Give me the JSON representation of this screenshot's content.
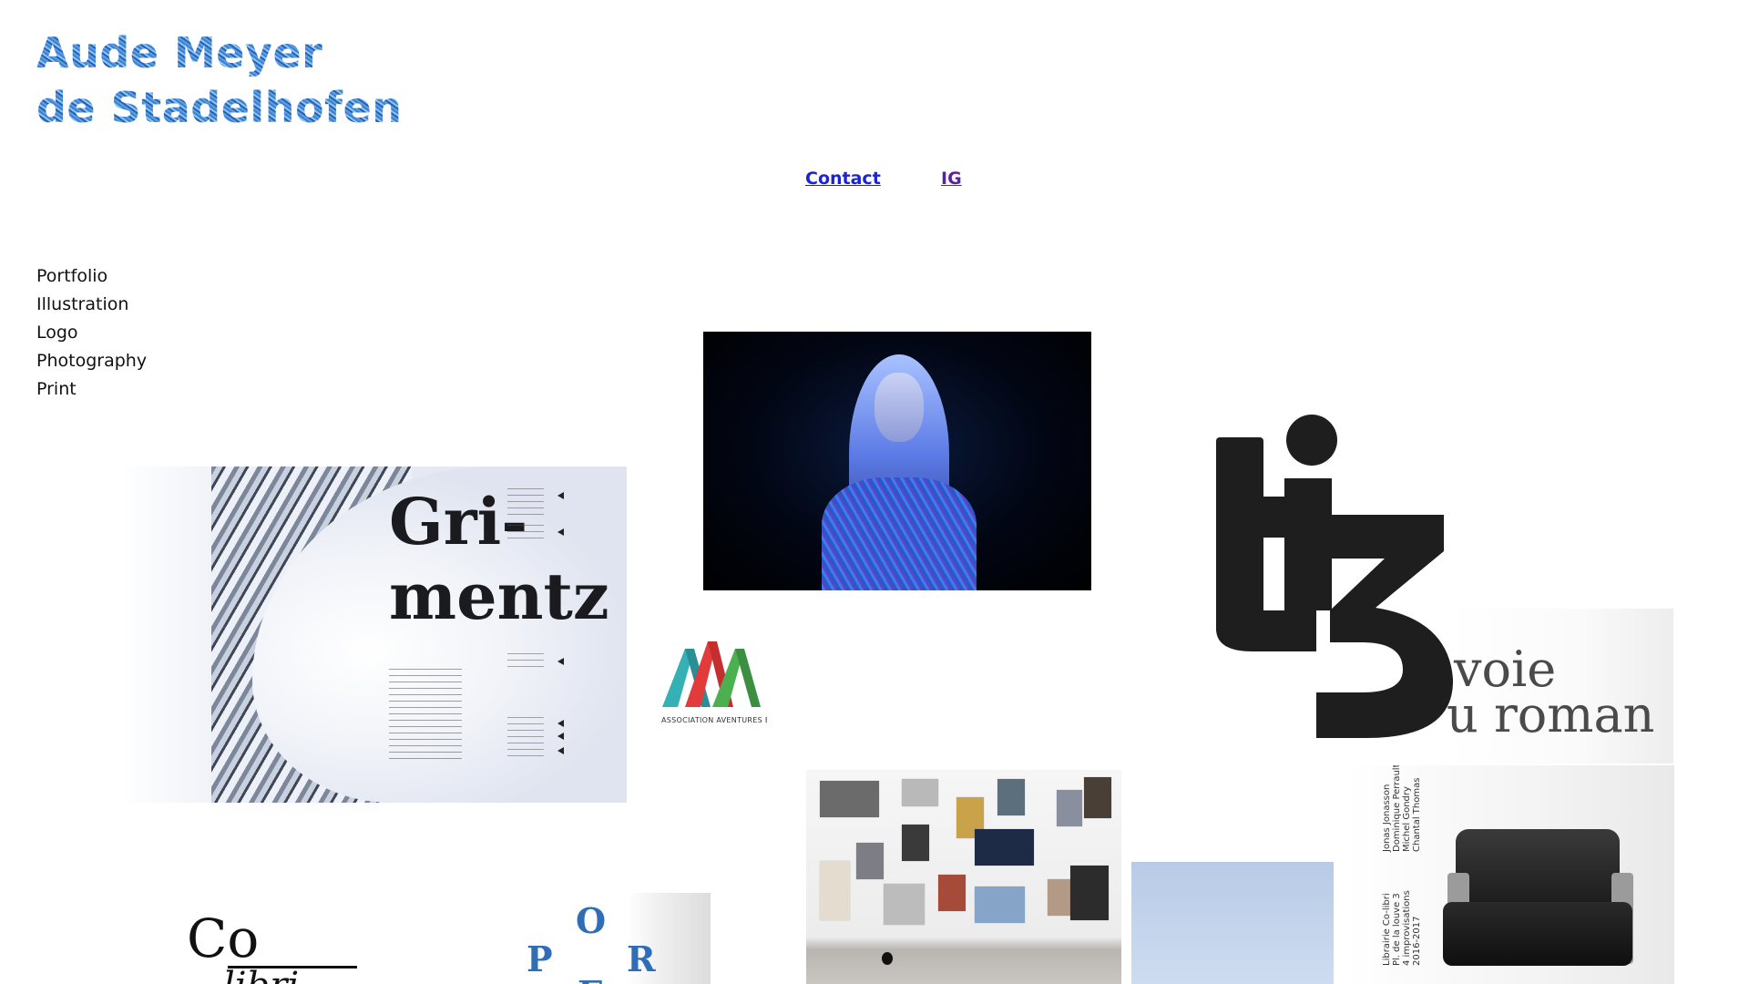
{
  "site": {
    "title_line1": "Aude Meyer",
    "title_line2": "de Stadelhofen"
  },
  "header_links": {
    "contact": "Contact",
    "ig": "IG"
  },
  "nav": {
    "items": [
      "Portfolio",
      "Illustration",
      "Logo",
      "Photography",
      "Print"
    ]
  },
  "tiles": {
    "grimentz": {
      "title_line1": "Gri-",
      "title_line2": "mentz"
    },
    "aaa": {
      "caption": "ASSOCIATION AVENTURES ET AMITIÉS"
    },
    "roman": {
      "line1": "voie",
      "line2": "u roman"
    },
    "armchair": {
      "names": "Jonas Jonasson\nDominique Perrault\nMichel Gondry\nChantal Thomas",
      "venue": "Librairie Co-libri\nPl. de la louve 3\n4 improvisations\n2016-2017"
    },
    "colibri": {
      "co": "Co",
      "libri": "libri"
    },
    "opera": {
      "l1": "O",
      "l2": "P",
      "l3": "R",
      "l4": "E"
    }
  },
  "colors": {
    "contact_link": "#1a24d6",
    "ig_link": "#5b1fa8",
    "logo_gradient": [
      "#5aa0e6",
      "#2c5fb0",
      "#8ac6f5"
    ],
    "aaa": [
      "#35b0b5",
      "#e23b3b",
      "#4caf50"
    ]
  },
  "icons": [
    "tiz-logo",
    "aaa-logo"
  ]
}
